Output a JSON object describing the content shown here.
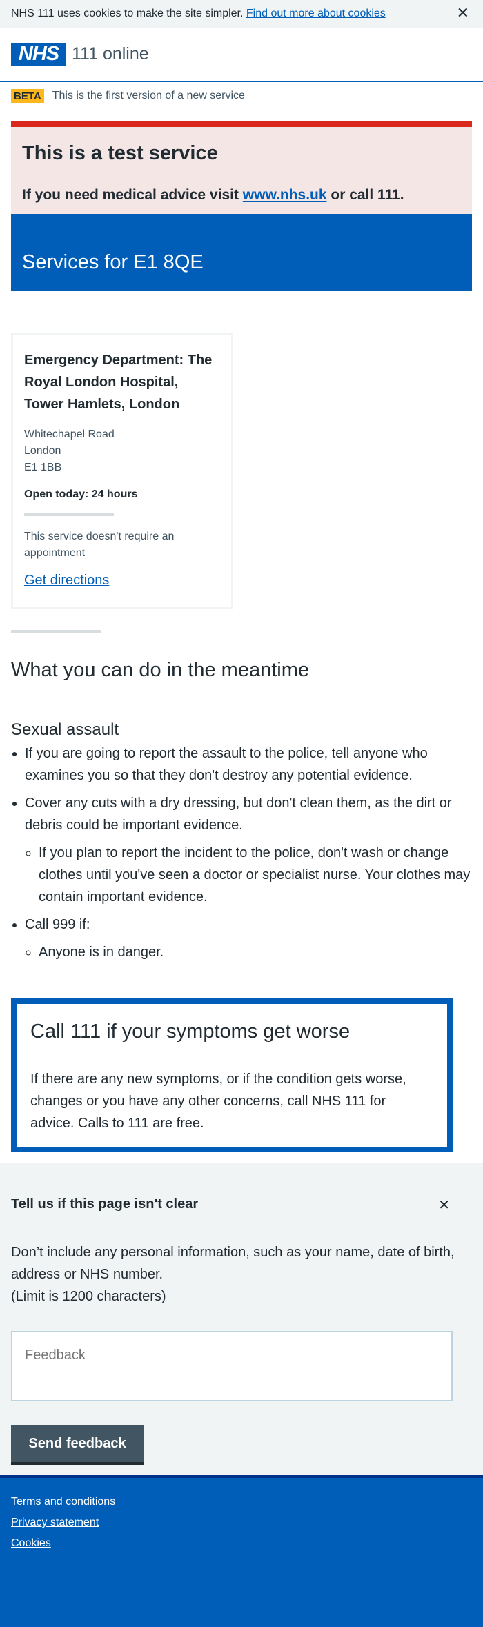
{
  "cookie_banner": {
    "text": "NHS 111 uses cookies to make the site simpler.",
    "link": "Find out more about cookies",
    "close": "✕"
  },
  "header": {
    "logo": "NHS",
    "service": "111 online"
  },
  "beta": {
    "tag": "BETA",
    "text": "This is the first version of a new service"
  },
  "test_service": {
    "title": "This is a test service",
    "text_before": "If you need medical advice visit ",
    "link": "www.nhs.uk",
    "text_after": " or call 111."
  },
  "services_title": "Services for E1 8QE",
  "service_card": {
    "name": "Emergency Department: The Royal London Hospital, Tower Hamlets, London",
    "address": [
      "Whitechapel Road",
      "London",
      "E1 1BB"
    ],
    "open": "Open today: 24 hours",
    "note": "This service doesn't require an appointment",
    "directions": "Get directions"
  },
  "meantime": {
    "title": "What you can do in the meantime",
    "subtitle": "Sexual assault",
    "item1": "If you are going to report the assault to the police, tell anyone who examines you so that they don't destroy any potential evidence.",
    "item2": "Cover any cuts with a dry dressing, but don't clean them, as the dirt or debris could be important evidence.",
    "item2_sub": "If you plan to report the incident to the police, don't wash or change clothes until you've seen a doctor or specialist nurse. Your clothes may contain important evidence.",
    "item3": "Call 999 if:",
    "item3_sub": "Anyone is in danger."
  },
  "care_card": {
    "title": "Call 111 if your symptoms get worse",
    "text": "If there are any new symptoms, or if the condition gets worse, changes or you have any other concerns, call NHS 111 for advice. Calls to 111 are free."
  },
  "feedback": {
    "title": "Tell us if this page isn't clear",
    "close": "✕",
    "hint": "Don’t include any personal information, such as your name, date of birth, address or NHS number.",
    "limit": "(Limit is 1200 characters)",
    "placeholder": "Feedback",
    "button": "Send feedback"
  },
  "footer": {
    "links": [
      "Terms and conditions",
      "Privacy statement",
      "Cookies"
    ]
  }
}
